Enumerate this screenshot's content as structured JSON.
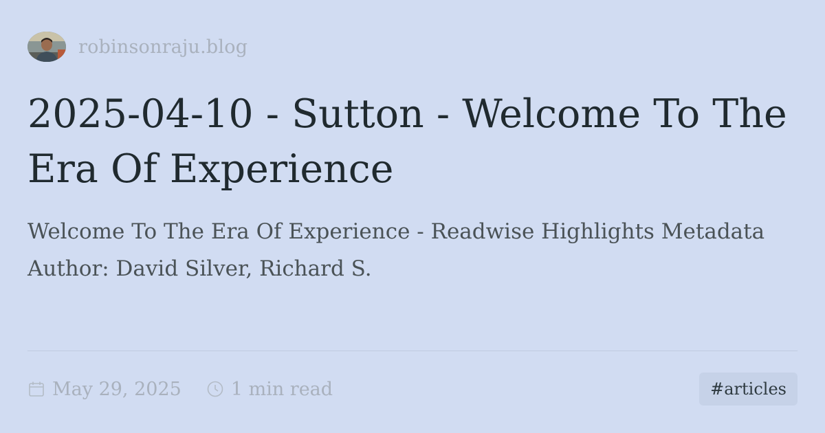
{
  "site": {
    "name": "robinsonraju.blog",
    "avatar_icon": "author-avatar"
  },
  "post": {
    "title": "2025-04-10 - Sutton - Welcome To The Era Of Experience",
    "description": "Welcome To The Era Of Experience - Readwise Highlights Metadata Author: David Silver, Richard S."
  },
  "footer": {
    "date": "May 29, 2025",
    "date_icon": "calendar-icon",
    "read_time": "1 min read",
    "read_time_icon": "clock-icon",
    "tag": "#articles"
  },
  "colors": {
    "background": "#d1dcf2",
    "title": "#202a2f",
    "muted": "#a9b1bd",
    "tag_bg": "#c6d2e8"
  }
}
